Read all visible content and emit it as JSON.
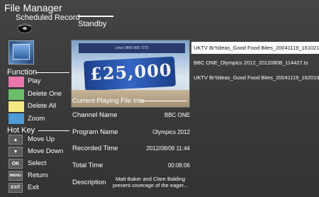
{
  "header": {
    "title": "File Manager",
    "subtitle": "Scheduled Record",
    "status": "Standby",
    "disc_icon": "disc-icon"
  },
  "function": {
    "heading": "Function",
    "items": [
      {
        "label": "Play",
        "color": "#e877ad"
      },
      {
        "label": "Delete One",
        "color": "#6dbd6a"
      },
      {
        "label": "Delete All",
        "color": "#f4e982"
      },
      {
        "label": "Zoom",
        "color": "#4c9ad6"
      }
    ]
  },
  "hotkey": {
    "heading": "Hot Key",
    "items": [
      {
        "key": "▲",
        "label": "Move Up"
      },
      {
        "key": "▼",
        "label": "Move Down"
      },
      {
        "key": "OK",
        "label": "Select"
      },
      {
        "key": "MENU",
        "label": "Return"
      },
      {
        "key": "EXIT",
        "label": "Exit"
      }
    ]
  },
  "preview": {
    "amount": "£25,000",
    "top_text": "Lines 0800 068 7272"
  },
  "info": {
    "heading": "Current Playing File Into",
    "rows": [
      {
        "label": "Channel Name",
        "value": "BBC ONE"
      },
      {
        "label": "Program Name",
        "value": "Olympics 2012"
      },
      {
        "label": "Recorded Time",
        "value": "2012/08/09 11:44"
      },
      {
        "label": "Total Time",
        "value": "00:08:06"
      },
      {
        "label": "Description",
        "value": "Matt Baker and Clare Balding present coverage of the eager..."
      }
    ]
  },
  "files": [
    "UKTV Br'tIdeas_Good Food Bites_20041119_161021.ts",
    "BBC ONE_Olympics 2012_20120808_114427.ts",
    "UKTV Br'tIdeas_Good Food Bites_20041119_162019.ts"
  ]
}
